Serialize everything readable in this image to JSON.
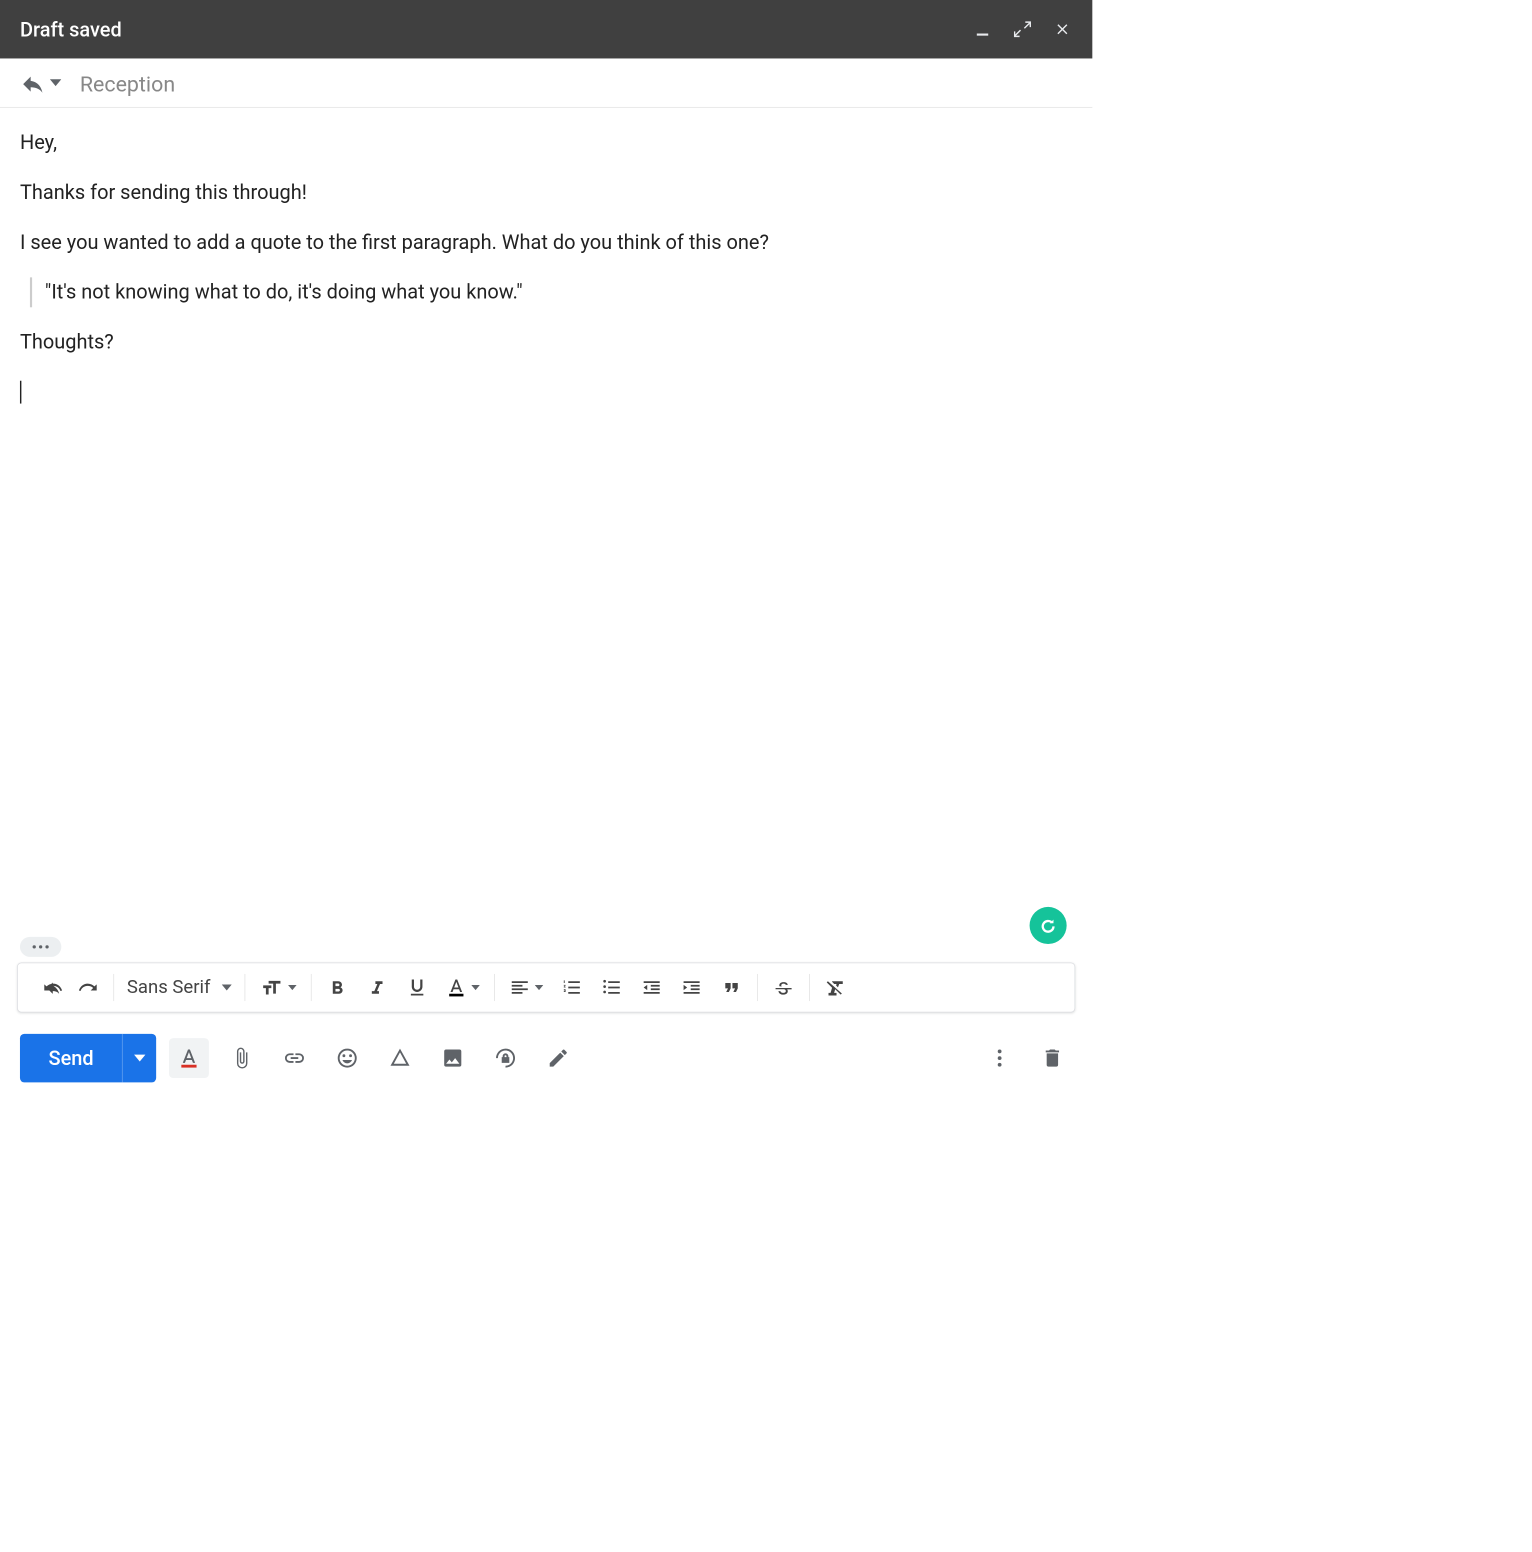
{
  "titlebar": {
    "title": "Draft saved"
  },
  "subject": "Reception",
  "body": {
    "p1": "Hey,",
    "p2": "Thanks for sending this through!",
    "p3": "I see you wanted to add a quote to the first paragraph. What do you think of this one?",
    "quote": "\"It's not knowing what to do, it's doing what you know.\"",
    "p4": "Thoughts?"
  },
  "toolbar": {
    "font": "Sans Serif"
  },
  "send": {
    "label": "Send"
  },
  "colors": {
    "accent": "#1a73e8",
    "grammarly": "#15c39a"
  }
}
